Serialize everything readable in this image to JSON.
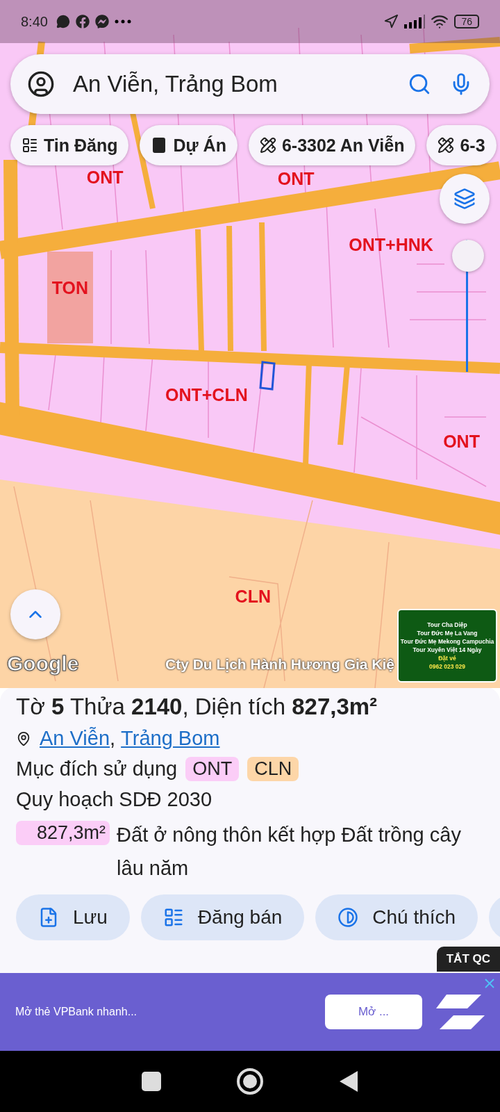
{
  "status_bar": {
    "time": "8:40",
    "battery": "76"
  },
  "search": {
    "value": "An Viễn, Trảng Bom"
  },
  "chips": [
    {
      "label": "Tin Đăng",
      "kind": "listing"
    },
    {
      "label": "Dự Án",
      "kind": "project"
    },
    {
      "label": "6-3302 An Viễn",
      "kind": "plan"
    },
    {
      "label": "6-3",
      "kind": "plan"
    }
  ],
  "map": {
    "zones": [
      {
        "label": "ONT"
      },
      {
        "label": "ONT"
      },
      {
        "label": "ONT+HNK"
      },
      {
        "label": "TON"
      },
      {
        "label": "ONT+CLN"
      },
      {
        "label": "ONT"
      },
      {
        "label": "CLN"
      }
    ],
    "opacity_slider": {
      "level": 1
    },
    "logo": "Google",
    "attribution": "Cty Du Lịch Hành Hương Gia Kiệ",
    "ad_thumbnail": [
      "Tour Cha Diệp",
      "Tour Đức Mẹ La Vang",
      "Tour Đức Mẹ Mekong Campuchia",
      "Tour Xuyên Việt 14 Ngày",
      "Đặt vé",
      "0962 023 029"
    ]
  },
  "parcel": {
    "title": "Tờ **5** Thửa **2140**, Diện tích **827,3m²**",
    "location": [
      "An Viễn",
      "Trảng Bom"
    ],
    "location_separator": ",",
    "purpose_label": "Mục đích sử dụng",
    "purpose_tags": [
      {
        "label": "ONT",
        "color": "#fbcdf7"
      },
      {
        "label": "CLN",
        "color": "#fdd6a8"
      }
    ],
    "plan_label": "Quy hoạch SDĐ 2030",
    "plan_rows": [
      {
        "area": "827,3m²",
        "description": "Đất ở nông thôn kết hợp Đất trồng cây lâu năm",
        "color": "#fbcdf7"
      }
    ],
    "actions": [
      {
        "label": "Lưu",
        "kind": "save"
      },
      {
        "label": "Đăng bán",
        "kind": "sell"
      },
      {
        "label": "Chú thích",
        "kind": "legend"
      },
      {
        "kind": "photo"
      }
    ]
  },
  "ad": {
    "close_label": "TẮT QC",
    "text": "Mở thẻ VPBank nhanh...",
    "button": "Mở ..."
  }
}
